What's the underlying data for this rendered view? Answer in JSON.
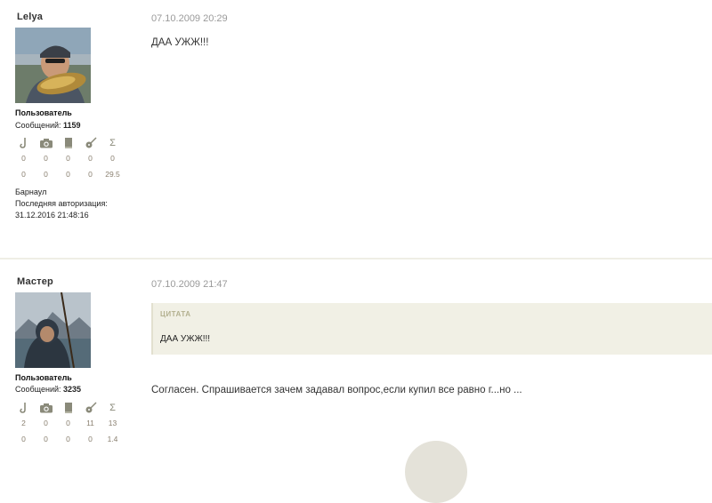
{
  "posts": [
    {
      "username": "Lelya",
      "role": "Пользователь",
      "messages_label": "Сообщений:",
      "messages_count": "1159",
      "stats_row1": [
        "0",
        "0",
        "0",
        "0",
        "0"
      ],
      "stats_row2": [
        "0",
        "0",
        "0",
        "0",
        "29.5"
      ],
      "city": "Барнаул",
      "last_login_label": "Последняя авторизация:",
      "last_login": "31.12.2016 21:48:16",
      "date": "07.10.2009 20:29",
      "text": "ДАА УЖЖ!!!"
    },
    {
      "username": "Мастер",
      "role": "Пользователь",
      "messages_label": "Сообщений:",
      "messages_count": "3235",
      "stats_row1": [
        "2",
        "0",
        "0",
        "11",
        "13"
      ],
      "stats_row2": [
        "0",
        "0",
        "0",
        "0",
        "1.4"
      ],
      "date": "07.10.2009 21:47",
      "quote_label": "ЦИТАТА",
      "quote_text": "ДАА УЖЖ!!!",
      "text": "Согласен. Спрашивается зачем задавал вопрос,если купил все равно г...но ..."
    }
  ],
  "icons": [
    "hook-icon",
    "camera-icon",
    "book-icon",
    "guitar-icon",
    "sigma-icon"
  ],
  "colors": {
    "quote_bg": "#f1f0e5",
    "divider": "#efeee5",
    "stat_text": "#8a8070",
    "date_text": "#9a9a9a"
  }
}
